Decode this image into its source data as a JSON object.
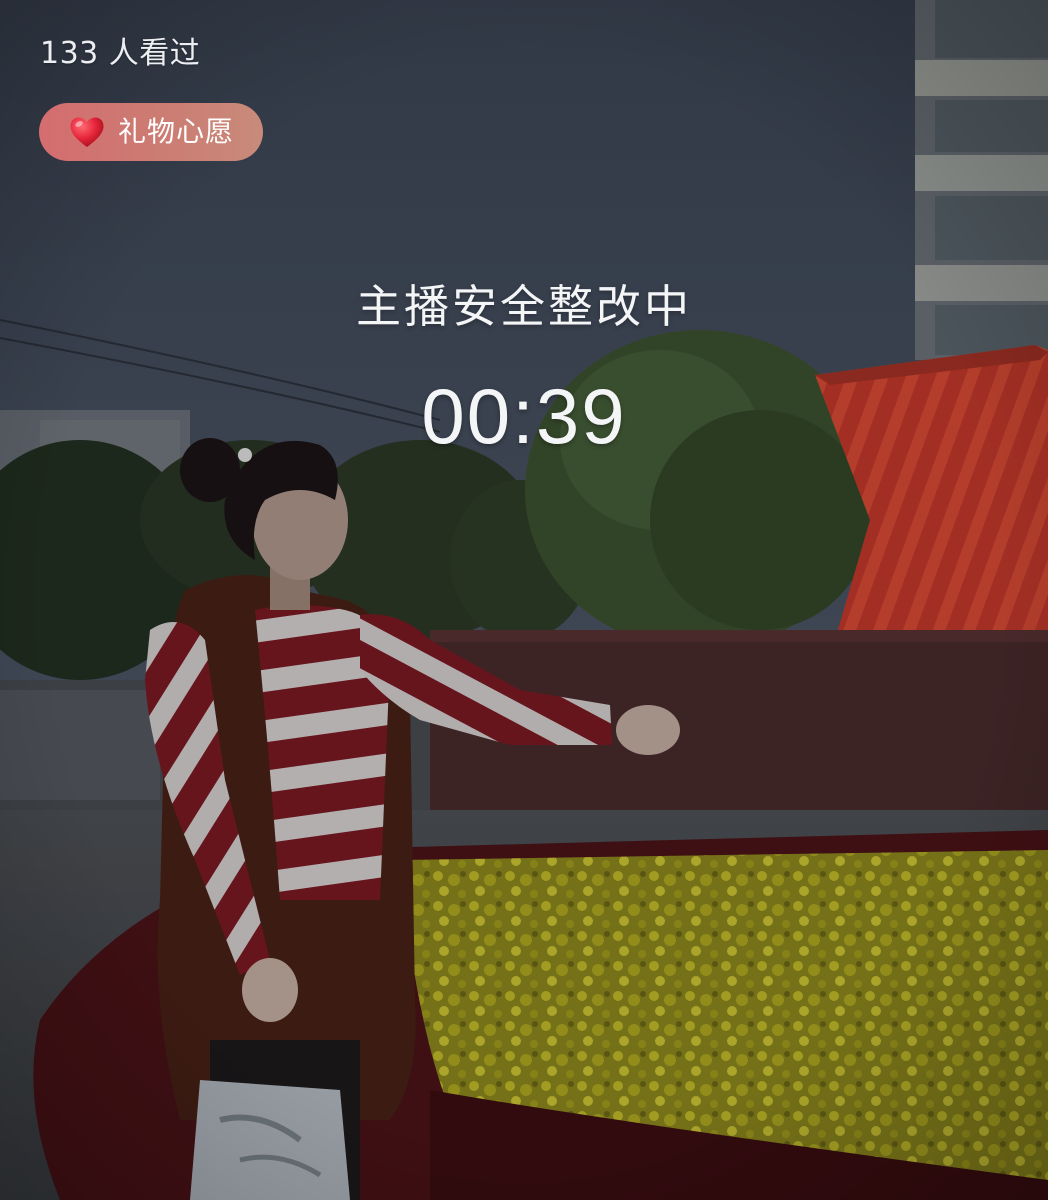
{
  "live_room": {
    "viewer_count_text": "133 人看过",
    "gift_wish": {
      "label": "礼物心愿",
      "icon": "heart-icon",
      "icon_color": "#e5243a",
      "pill_color": "#d26f70"
    },
    "status_message": "主播安全整改中",
    "countdown": "00:39"
  }
}
